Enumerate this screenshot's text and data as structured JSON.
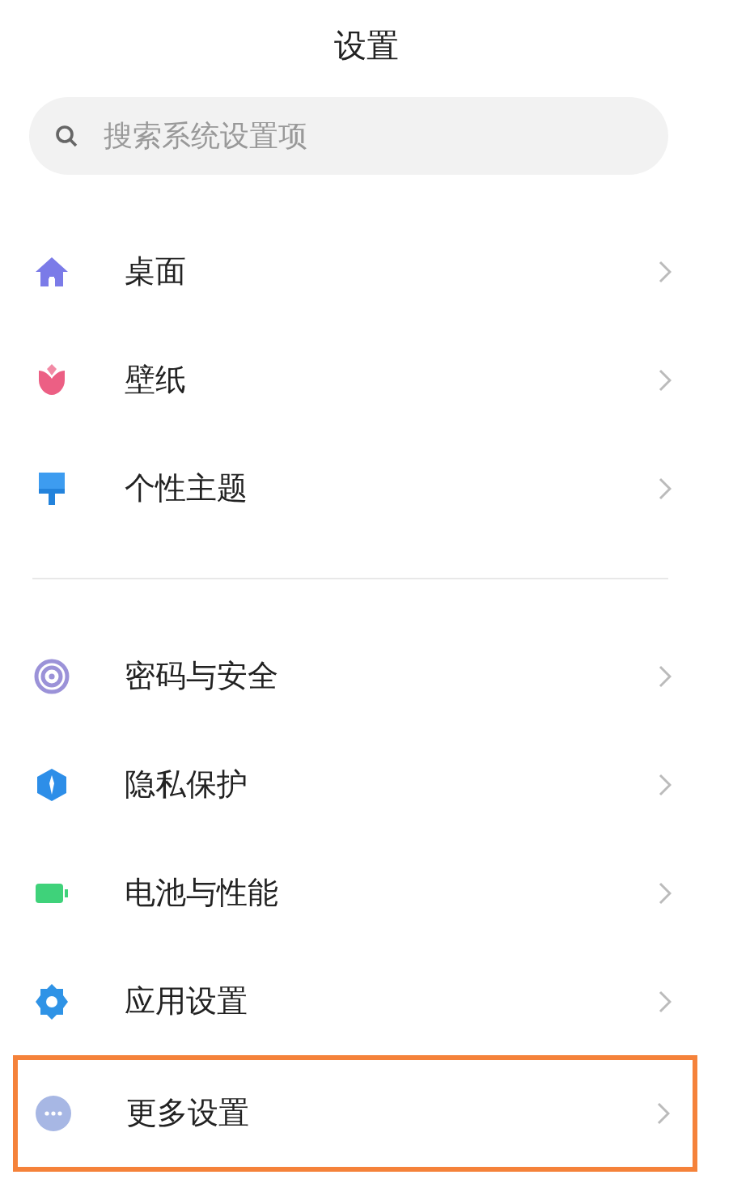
{
  "title": "设置",
  "search": {
    "placeholder": "搜索系统设置项"
  },
  "groups": [
    {
      "items": [
        {
          "label": "桌面",
          "highlighted": false
        },
        {
          "label": "壁纸",
          "highlighted": false
        },
        {
          "label": "个性主题",
          "highlighted": false
        }
      ]
    },
    {
      "items": [
        {
          "label": "密码与安全",
          "highlighted": false
        },
        {
          "label": "隐私保护",
          "highlighted": false
        },
        {
          "label": "电池与性能",
          "highlighted": false
        },
        {
          "label": "应用设置",
          "highlighted": false
        },
        {
          "label": "更多设置",
          "highlighted": true
        }
      ]
    }
  ]
}
